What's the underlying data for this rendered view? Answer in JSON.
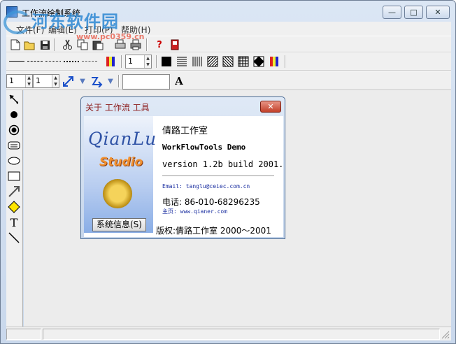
{
  "window": {
    "title": "工作流绘制系统",
    "controls": {
      "minimize": "—",
      "maximize": "□",
      "close": "✕"
    }
  },
  "watermark": {
    "site_name": "河东软件园",
    "url": "www.pc0359.cn"
  },
  "menu": [
    {
      "label": "文件(F)"
    },
    {
      "label": "编辑(E)"
    },
    {
      "label": "打印(P)"
    },
    {
      "label": "帮助(H)"
    }
  ],
  "toolbar": {
    "file_buttons": [
      "new-icon",
      "open-icon",
      "save-icon",
      "cut-icon",
      "copy-icon",
      "paste-icon",
      "print-preview-icon",
      "print-icon",
      "help-icon",
      "exit-icon"
    ],
    "line_width_value": "1",
    "spin_left_value": "1",
    "spin_right_value": "1",
    "font_button_label": "A",
    "text_input_value": ""
  },
  "palette": [
    "pointer-icon",
    "filled-circle-icon",
    "ringed-circle-icon",
    "rounded-rect-icon",
    "ellipse-icon",
    "rectangle-icon",
    "arrow-line-icon",
    "diamond-icon",
    "text-icon",
    "line-icon"
  ],
  "about_dialog": {
    "title": "关于 工作流 工具",
    "close_label": "✕",
    "logo_name": "QianLu",
    "logo_sub": "Studio",
    "studio": "倩路工作室",
    "product": "WorkFlowTools Demo",
    "version": "version 1.2b  build 2001.",
    "email": "Email: tanglu@ceiec.com.cn",
    "phone": "电话:  86-010-68296235",
    "homepage": "主页: www.qianer.com",
    "copyright": "版权:倩路工作室 2000～2001",
    "sysinfo_button": "系统信息(S)"
  },
  "colors": {
    "canvas_bg": "#ececec",
    "dialog_close": "#c2402a",
    "link_text": "#1a2ea0"
  }
}
